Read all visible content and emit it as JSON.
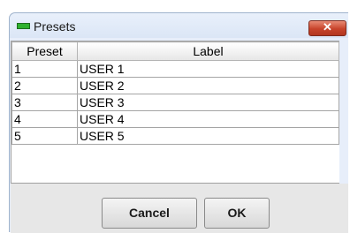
{
  "window": {
    "title": "Presets",
    "close_label": "✕",
    "icon": "green-led-icon",
    "accent_color": "#c7432b"
  },
  "table": {
    "columns": [
      "Preset",
      "Label"
    ],
    "rows": [
      {
        "preset": "1",
        "label": "USER 1"
      },
      {
        "preset": "2",
        "label": "USER 2"
      },
      {
        "preset": "3",
        "label": "USER 3"
      },
      {
        "preset": "4",
        "label": "USER 4"
      },
      {
        "preset": "5",
        "label": "USER 5"
      }
    ]
  },
  "buttons": {
    "cancel": "Cancel",
    "ok": "OK"
  }
}
